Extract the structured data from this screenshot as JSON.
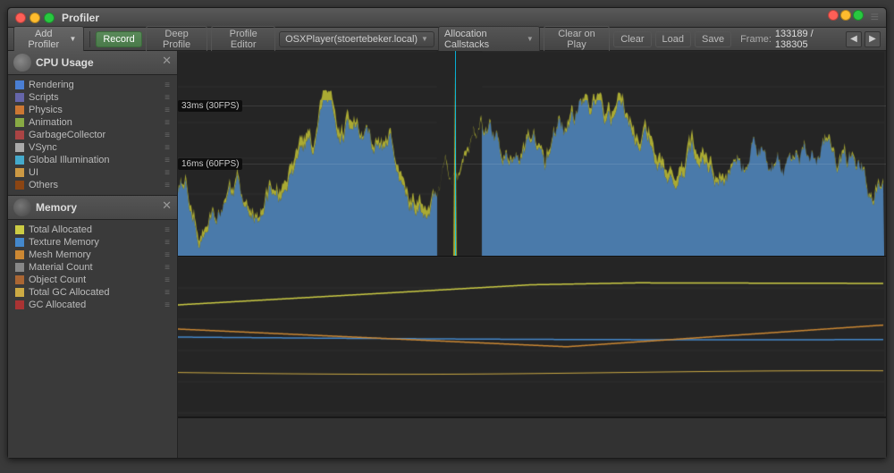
{
  "window": {
    "title": "Profiler",
    "buttons": {
      "red": "close",
      "yellow": "minimize",
      "green": "maximize"
    }
  },
  "toolbar": {
    "add_profiler_label": "Add Profiler",
    "record_label": "Record",
    "deep_profile_label": "Deep Profile",
    "profile_editor_label": "Profile Editor",
    "connection_label": "OSXPlayer(stoertebeker.local)",
    "allocation_callstacks_label": "Allocation Callstacks",
    "clear_on_play_label": "Clear on Play",
    "clear_label": "Clear",
    "load_label": "Load",
    "save_label": "Save",
    "frame_label": "Frame:",
    "frame_value": "133189 / 138305",
    "prev_frame_label": "◀",
    "next_frame_label": "▶"
  },
  "cpu_panel": {
    "title": "CPU Usage",
    "close_label": "✕",
    "marker_30fps": "33ms (30FPS)",
    "marker_60fps": "16ms (60FPS)",
    "legend_items": [
      {
        "label": "Rendering",
        "color": "#4a7fd4"
      },
      {
        "label": "Scripts",
        "color": "#6666aa"
      },
      {
        "label": "Physics",
        "color": "#cc7733"
      },
      {
        "label": "Animation",
        "color": "#88aa44"
      },
      {
        "label": "GarbageCollector",
        "color": "#aa4444"
      },
      {
        "label": "VSync",
        "color": "#aaaaaa"
      },
      {
        "label": "Global Illumination",
        "color": "#44aacc"
      },
      {
        "label": "UI",
        "color": "#cc9944"
      },
      {
        "label": "Others",
        "color": "#8b4513"
      }
    ]
  },
  "memory_panel": {
    "title": "Memory",
    "close_label": "✕",
    "legend_items": [
      {
        "label": "Total Allocated",
        "color": "#cccc44"
      },
      {
        "label": "Texture Memory",
        "color": "#4488cc"
      },
      {
        "label": "Mesh Memory",
        "color": "#cc8833"
      },
      {
        "label": "Material Count",
        "color": "#888888"
      },
      {
        "label": "Object Count",
        "color": "#aa6633"
      },
      {
        "label": "Total GC Allocated",
        "color": "#ccaa44"
      },
      {
        "label": "GC Allocated",
        "color": "#aa3333"
      }
    ]
  },
  "colors": {
    "bg_dark": "#1e1e1e",
    "bg_panel": "#2a2a2a",
    "sidebar": "#3a3a3a",
    "accent_blue": "#00cfff",
    "cpu_blue": "#5588bb",
    "cpu_yellow": "#cccc44"
  }
}
